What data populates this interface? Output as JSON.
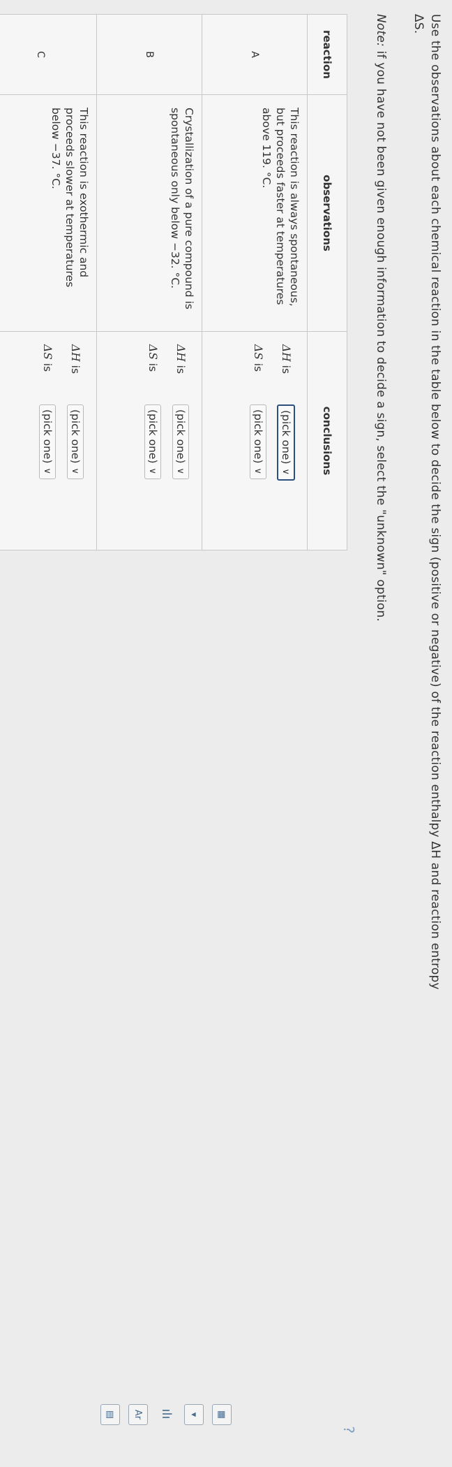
{
  "instructions": {
    "line1": "Use the observations about each chemical reaction in the table below to decide the sign (positive or negative) of the reaction enthalpy ΔH and reaction entropy",
    "line2": "ΔS.",
    "note_prefix": "Note:",
    "note_text": "if you have not been given enough information to decide a sign, select the \"unknown\" option."
  },
  "table": {
    "headers": {
      "reaction": "reaction",
      "observations": "observations",
      "conclusions": "conclusions"
    },
    "rows": [
      {
        "reaction": "A",
        "observation": "This reaction is always spontaneous, but proceeds faster at temperatures above 119. °C.",
        "dh_label": "ΔH",
        "ds_label": "ΔS",
        "is_text": "is",
        "dh_value": "(pick one)",
        "ds_value": "(pick one)"
      },
      {
        "reaction": "B",
        "observation": "Crystallization of a pure compound is spontaneous only below −32. °C.",
        "dh_label": "ΔH",
        "ds_label": "ΔS",
        "is_text": "is",
        "dh_value": "(pick one)",
        "ds_value": "(pick one)"
      },
      {
        "reaction": "C",
        "observation": "This reaction is exothermic and proceeds slower at temperatures below −37. °C.",
        "dh_label": "ΔH",
        "ds_label": "ΔS",
        "is_text": "is",
        "dh_value": "(pick one)",
        "ds_value": "(pick one)"
      }
    ]
  },
  "icons": {
    "help": "help-icon",
    "side_tools": [
      "calculator-icon",
      "dropdown-icon",
      "chart-icon",
      "periodic-table-icon",
      "data-table-icon"
    ]
  },
  "accent_color": "#2d4f7c"
}
